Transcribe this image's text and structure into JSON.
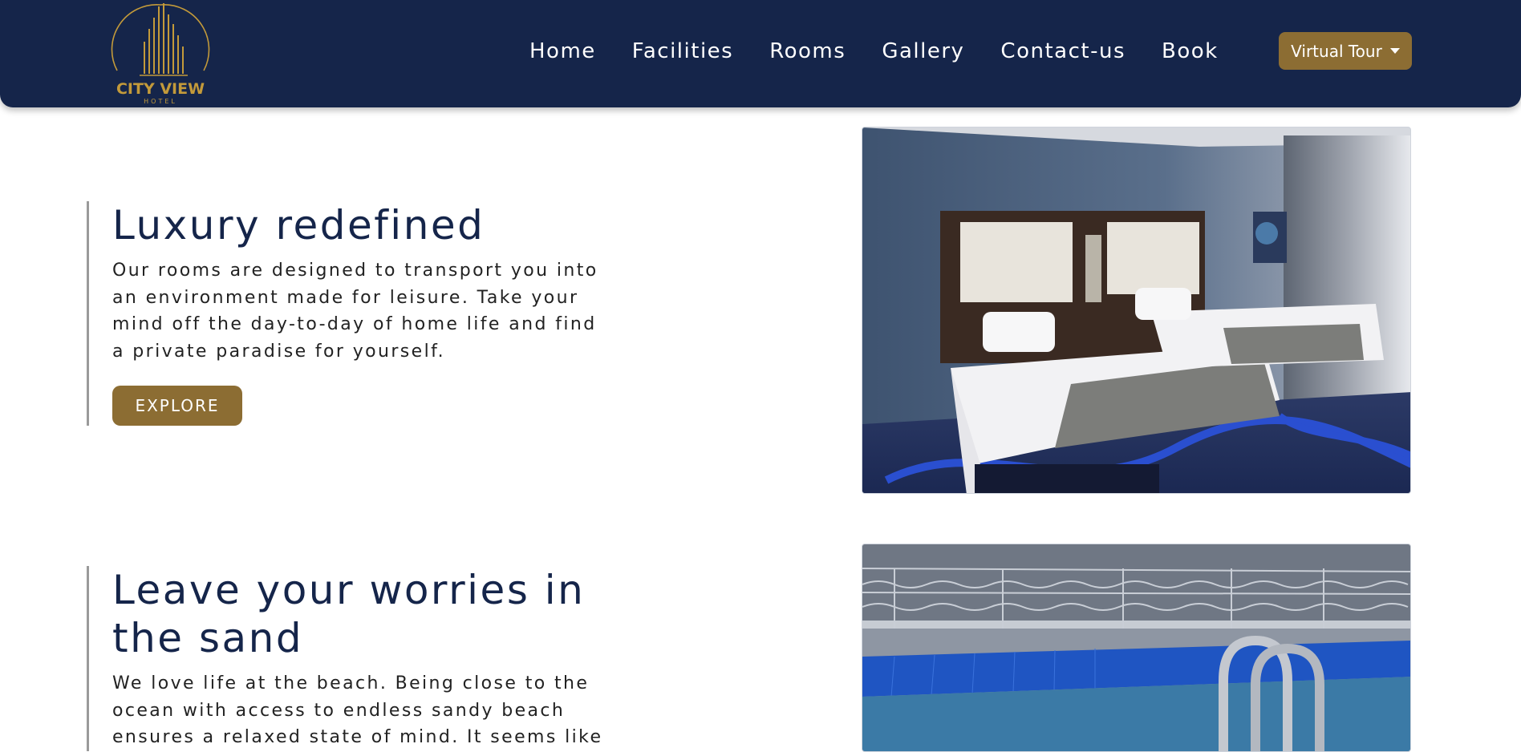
{
  "brand": {
    "name": "CITY VIEW",
    "sub": "HOTEL",
    "gold": "#c39a3a",
    "navy": "#15254a",
    "button_brown": "#8c6d33"
  },
  "nav": {
    "links": [
      "Home",
      "Facilities",
      "Rooms",
      "Gallery",
      "Contact-us",
      "Book"
    ],
    "tour_label": "Virtual Tour"
  },
  "sections": [
    {
      "heading": "Luxury redefined",
      "body": "Our rooms are designed to transport you into an environment made for leisure. Take your mind off the day-to-day of home life and find a private paradise for yourself.",
      "button": "EXPLORE",
      "image": "hotel-bedroom-photo"
    },
    {
      "heading": "Leave your worries in the sand",
      "body": "We love life at the beach. Being close to the ocean with access to endless sandy beach ensures a relaxed state of mind. It seems like",
      "image": "indoor-pool-photo"
    }
  ]
}
